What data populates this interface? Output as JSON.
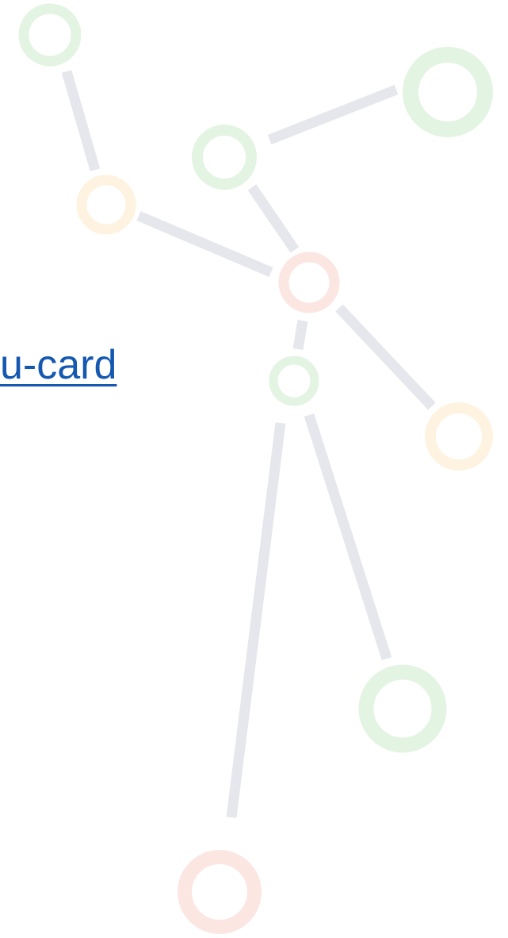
{
  "link": {
    "text": "u-card"
  },
  "colors": {
    "link": "#1558b0",
    "edge": "#e6e7ec",
    "node_green": "#e3f4e2",
    "node_yellow": "#fdf3e0",
    "node_red": "#fbe6e2",
    "background": "#ffffff"
  },
  "decoration": {
    "type": "faint network graph of ringed nodes joined by grey bars",
    "node_count": 10,
    "edge_count": 9
  }
}
